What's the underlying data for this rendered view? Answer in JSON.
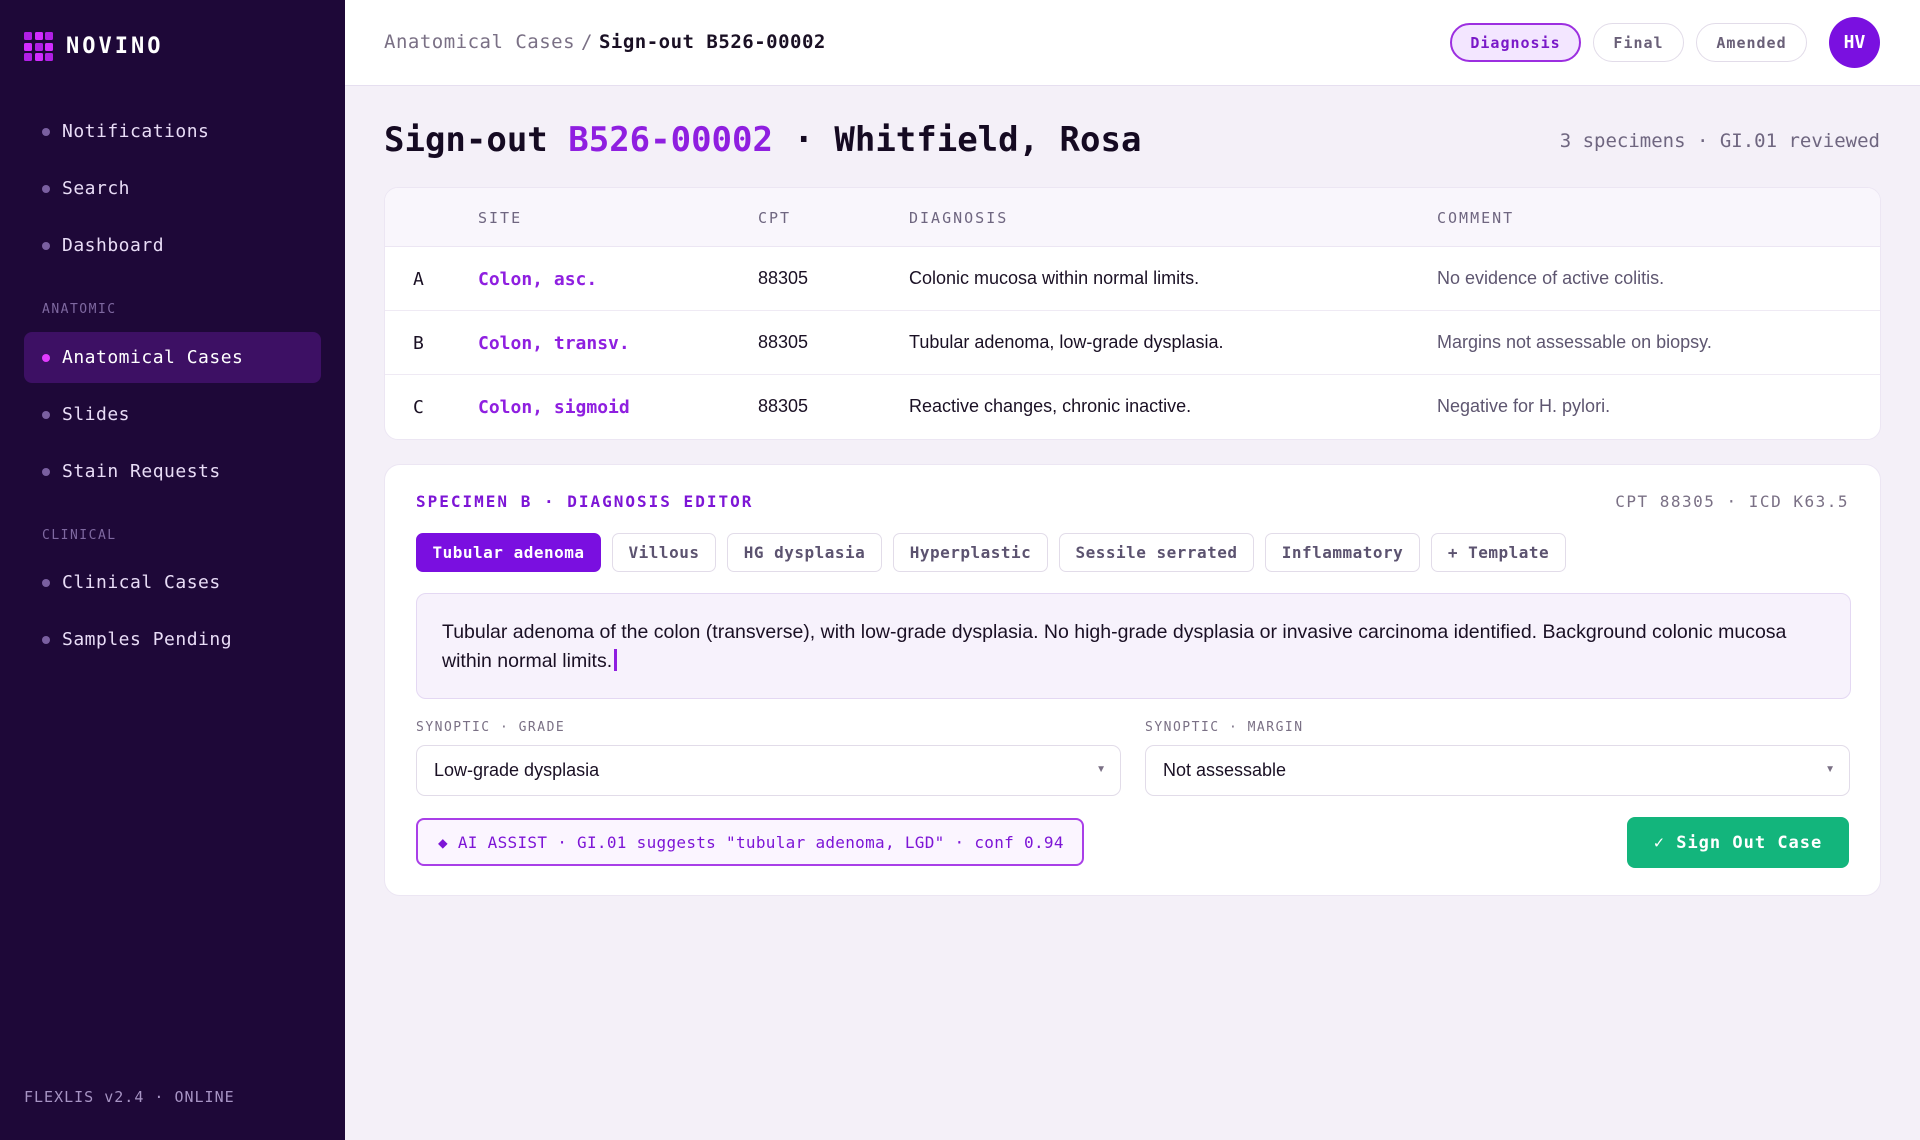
{
  "app": {
    "name": "NOVINO",
    "footer": "FLEXLIS v2.4 · ONLINE"
  },
  "sidebar": {
    "top_items": [
      {
        "label": "Notifications"
      },
      {
        "label": "Search"
      },
      {
        "label": "Dashboard"
      }
    ],
    "sections": [
      {
        "title": "ANATOMIC",
        "items": [
          {
            "label": "Anatomical Cases",
            "active": true
          },
          {
            "label": "Slides"
          },
          {
            "label": "Stain Requests"
          }
        ]
      },
      {
        "title": "CLINICAL",
        "items": [
          {
            "label": "Clinical Cases"
          },
          {
            "label": "Samples Pending"
          }
        ]
      }
    ]
  },
  "header": {
    "breadcrumb": {
      "parent": "Anatomical Cases",
      "separator": "/",
      "current": "Sign-out B526-00002"
    },
    "status_tabs": [
      {
        "label": "Diagnosis",
        "active": true
      },
      {
        "label": "Final"
      },
      {
        "label": "Amended"
      }
    ],
    "avatar_initials": "HV"
  },
  "page": {
    "title_prefix": "Sign-out",
    "case_id": "B526-00002",
    "title_suffix": "· Whitfield, Rosa",
    "meta": "3 specimens · GI.01 reviewed"
  },
  "specimens_table": {
    "columns": [
      "SITE",
      "CPT",
      "DIAGNOSIS",
      "COMMENT"
    ],
    "rows": [
      {
        "letter": "A",
        "site": "Colon, asc.",
        "cpt": "88305",
        "diagnosis": "Colonic mucosa within normal limits.",
        "comment": "No evidence of active colitis."
      },
      {
        "letter": "B",
        "site": "Colon, transv.",
        "cpt": "88305",
        "diagnosis": "Tubular adenoma, low-grade dysplasia.",
        "comment": "Margins not assessable on biopsy."
      },
      {
        "letter": "C",
        "site": "Colon, sigmoid",
        "cpt": "88305",
        "diagnosis": "Reactive changes, chronic inactive.",
        "comment": "Negative for H. pylori."
      }
    ]
  },
  "editor": {
    "title": "SPECIMEN B · DIAGNOSIS EDITOR",
    "codes": "CPT 88305 · ICD K63.5",
    "chips": [
      {
        "label": "Tubular adenoma",
        "selected": true
      },
      {
        "label": "Villous"
      },
      {
        "label": "HG dysplasia"
      },
      {
        "label": "Hyperplastic"
      },
      {
        "label": "Sessile serrated"
      },
      {
        "label": "Inflammatory"
      },
      {
        "label": "+ Template"
      }
    ],
    "text": "Tubular adenoma of the colon (transverse), with low-grade dysplasia. No high-grade dysplasia or invasive carcinoma identified. Background colonic mucosa within normal limits.",
    "grade": {
      "label": "SYNOPTIC · GRADE",
      "value": "Low-grade dysplasia"
    },
    "margin": {
      "label": "SYNOPTIC · MARGIN",
      "value": "Not assessable"
    },
    "ai_assist": "◆ AI ASSIST · GI.01 suggests \"tubular adenoma, LGD\" · conf 0.94",
    "signout_label": "✓ Sign Out Case"
  },
  "colors": {
    "sidebar_bg": "#1e0838",
    "accent": "#8f1fe0",
    "success": "#13b57c"
  }
}
